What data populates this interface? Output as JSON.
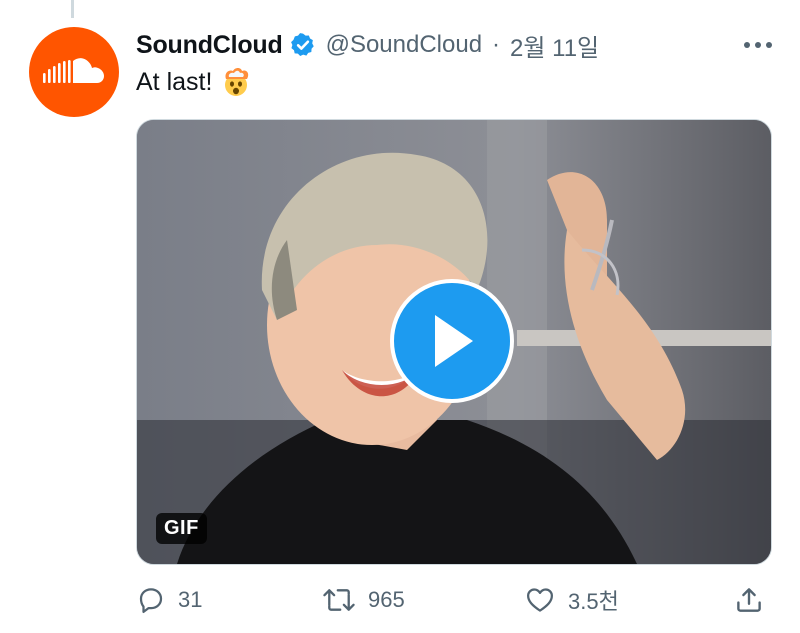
{
  "tweet": {
    "display_name": "SoundCloud",
    "verified": true,
    "handle": "@SoundCloud",
    "separator": "·",
    "date": "2월 11일",
    "text": "At last!",
    "emoji": "exploding-head-emoji"
  },
  "media": {
    "type": "gif",
    "badge_label": "GIF",
    "play_icon": "play-icon"
  },
  "actions": {
    "reply_count": "31",
    "retweet_count": "965",
    "like_count": "3.5천"
  },
  "colors": {
    "brand_avatar": "#ff5500",
    "verified_blue": "#1d9bf0",
    "muted_text": "#536471",
    "text": "#0f1419"
  }
}
